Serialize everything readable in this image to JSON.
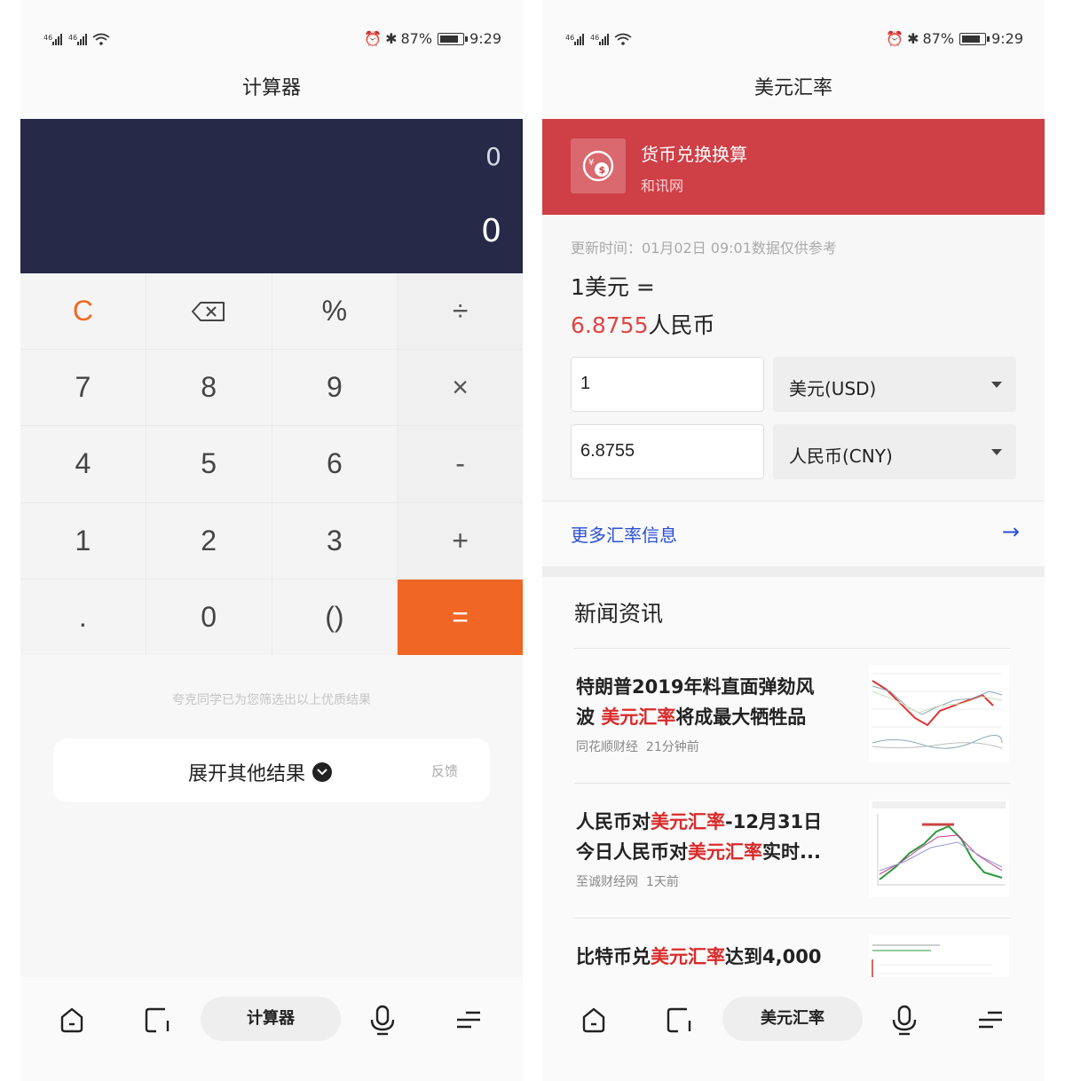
{
  "status": {
    "battery": "87%",
    "time": "9:29"
  },
  "left": {
    "title": "计算器",
    "display": {
      "expression": "0",
      "result": "0"
    },
    "keys": [
      "C",
      "⌫",
      "%",
      "÷",
      "7",
      "8",
      "9",
      "×",
      "4",
      "5",
      "6",
      "-",
      "1",
      "2",
      "3",
      "+",
      ".",
      "0",
      "()",
      "="
    ],
    "hint": "夸克同学已为您筛选出以上优质结果",
    "expand_label": "展开其他结果",
    "feedback": "反馈",
    "nav_pill": "计算器"
  },
  "right": {
    "title": "美元汇率",
    "banner": {
      "title": "货币兑换换算",
      "source": "和讯网"
    },
    "update_time": "更新时间：01月02日 09:01数据仅供参考",
    "rate_line1": "1美元 =",
    "rate_value": "6.8755",
    "rate_unit": "人民币",
    "converter": [
      {
        "amount": "1",
        "currency": "美元(USD)"
      },
      {
        "amount": "6.8755",
        "currency": "人民币(CNY)"
      }
    ],
    "more_rates": "更多汇率信息",
    "news_heading": "新闻资讯",
    "news": [
      {
        "t1": "特朗普",
        "t2": "2019",
        "t3": "年料直面弹劾风",
        "t4": "波 ",
        "hl": "美元汇率",
        "t5": "将成最大牺牲品",
        "source": "同花顺财经",
        "time": "21分钟前"
      },
      {
        "t1": "人民币对",
        "hl": "美元汇率",
        "t2": "-12月31日",
        "t3": "今日人民币对",
        "hl2": "美元汇率",
        "t4": "实时...",
        "source": "至诚财经网",
        "time": "1天前"
      },
      {
        "t1": "比特币兑",
        "hl": "美元汇率",
        "t2": "达到4,000"
      }
    ],
    "nav_pill": "美元汇率"
  },
  "colors": {
    "display_bg": "#262a48",
    "accent_orange": "#ef6625",
    "banner_red": "#cf3f46",
    "link_blue": "#2a4fd6",
    "highlight_red": "#d92b2b"
  },
  "nav_icons": [
    "home-icon",
    "tabs-icon",
    "microphone-icon",
    "menu-icon"
  ]
}
